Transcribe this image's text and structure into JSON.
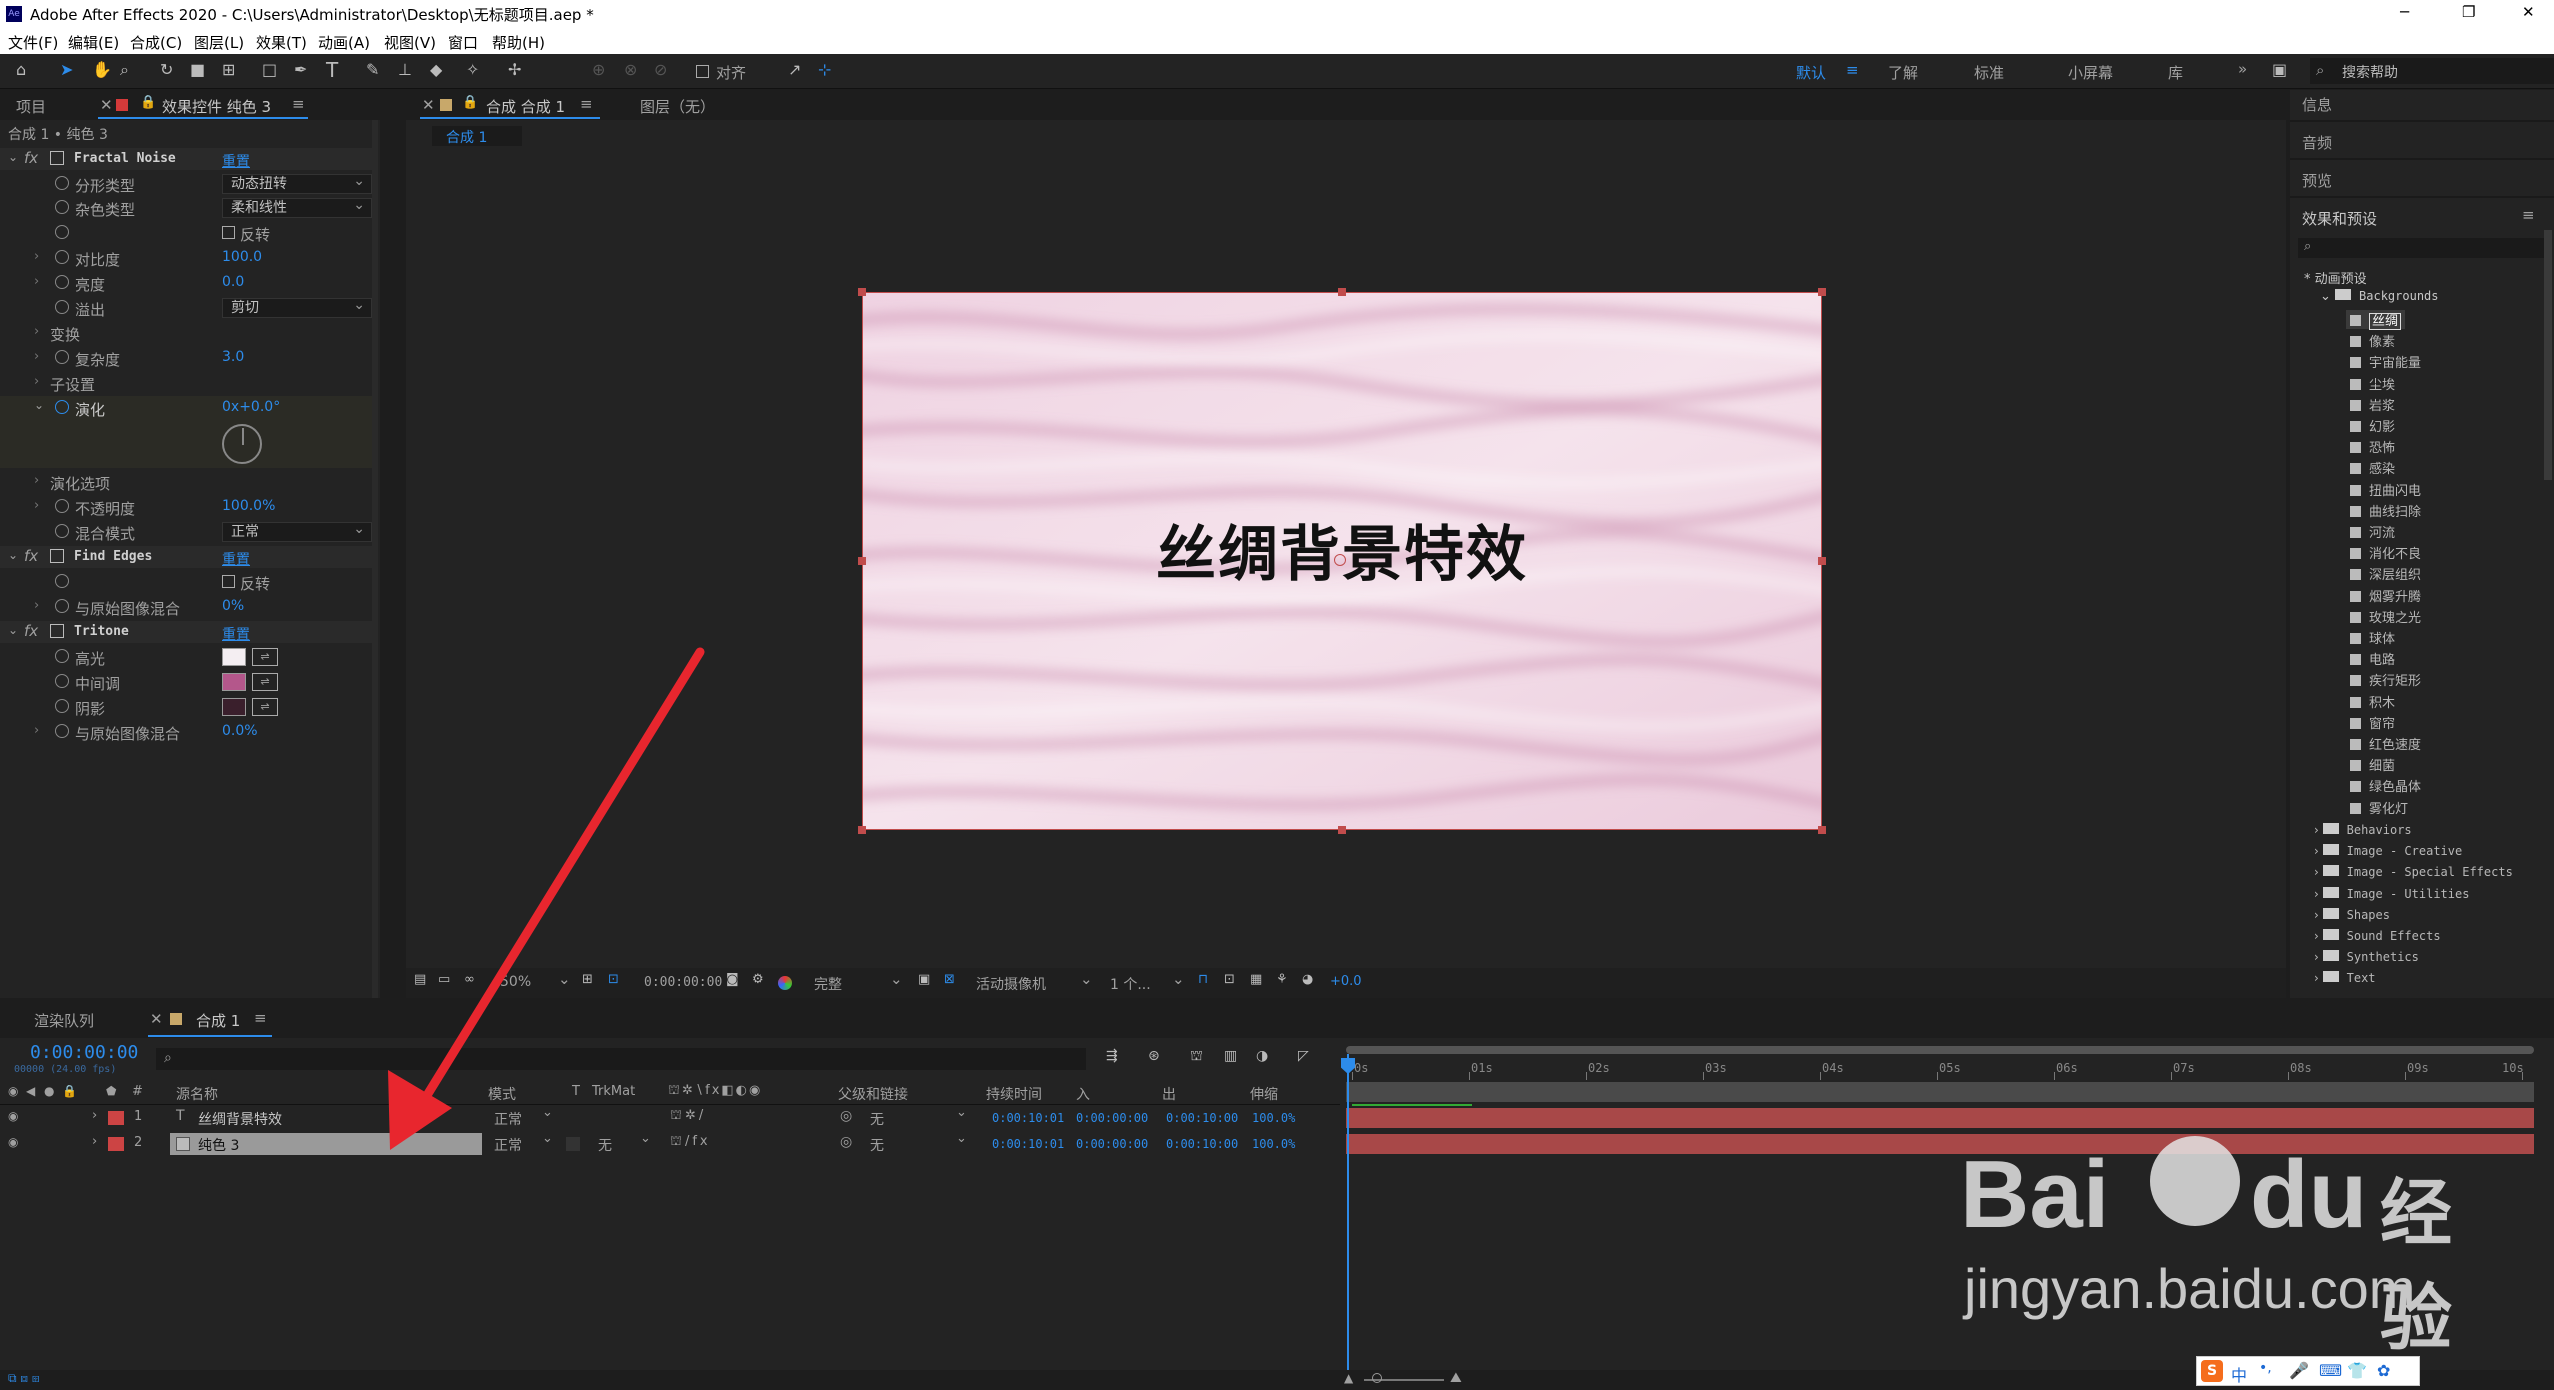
{
  "window": {
    "title": "Adobe After Effects 2020 - C:\\Users\\Administrator\\Desktop\\无标题项目.aep *",
    "controls": {
      "minimize": "─",
      "maximize": "❐",
      "close": "✕"
    }
  },
  "menu": [
    "文件(F)",
    "编辑(E)",
    "合成(C)",
    "图层(L)",
    "效果(T)",
    "动画(A)",
    "视图(V)",
    "窗口",
    "帮助(H)"
  ],
  "toolbar": {
    "align_label": "对齐",
    "workspaces": [
      "默认",
      "了解",
      "标准",
      "小屏幕",
      "库"
    ],
    "more": "»",
    "search_placeholder": "搜索帮助"
  },
  "left_panel": {
    "tab_project": "项目",
    "tab_effects": "效果控件 纯色 3",
    "subtitle": "合成 1 • 纯色 3",
    "reset": "重置",
    "effects": [
      {
        "name": "Fractal Noise"
      },
      {
        "name": "Find Edges"
      },
      {
        "name": "Tritone"
      }
    ],
    "fractal": {
      "fractal_type_label": "分形类型",
      "fractal_type_value": "动态扭转",
      "noise_type_label": "杂色类型",
      "noise_type_value": "柔和线性",
      "invert_label": "反转",
      "contrast_label": "对比度",
      "contrast_value": "100.0",
      "brightness_label": "亮度",
      "brightness_value": "0.0",
      "overflow_label": "溢出",
      "overflow_value": "剪切",
      "transform_label": "变换",
      "complexity_label": "复杂度",
      "complexity_value": "3.0",
      "sub_settings_label": "子设置",
      "evolution_label": "演化",
      "evolution_value": "0x+0.0°",
      "evolution_options_label": "演化选项",
      "opacity_label": "不透明度",
      "opacity_value": "100.0%",
      "blend_label": "混合模式",
      "blend_value": "正常"
    },
    "find_edges": {
      "invert_label": "反转",
      "blend_original_label": "与原始图像混合",
      "blend_original_value": "0%"
    },
    "tritone": {
      "highlights_label": "高光",
      "highlights_color": "#f4eef2",
      "midtones_label": "中间调",
      "midtones_color": "#b4578b",
      "shadows_label": "阴影",
      "shadows_color": "#3a1f2c",
      "blend_original_label": "与原始图像混合",
      "blend_original_value": "0.0%"
    }
  },
  "viewer": {
    "tab_comp": "合成 合成 1",
    "tab_layer": "图层（无）",
    "breadcrumb": "合成 1",
    "comp_text": "丝绸背景特效",
    "zoom": "50%",
    "timecode": "0:00:00:00",
    "resolution": "完整",
    "camera": "活动摄像机",
    "views": "1 个...",
    "exposure": "+0.0"
  },
  "right_panel": {
    "info": "信息",
    "audio": "音频",
    "preview": "预览",
    "effects_presets": "效果和预设",
    "tree_root": "* 动画预设",
    "backgrounds": "Backgrounds",
    "bg_items": [
      "丝绸",
      "像素",
      "宇宙能量",
      "尘埃",
      "岩浆",
      "幻影",
      "恐怖",
      "感染",
      "扭曲闪电",
      "曲线扫除",
      "河流",
      "消化不良",
      "深层组织",
      "烟雾升腾",
      "玫瑰之光",
      "球体",
      "电路",
      "疾行矩形",
      "积木",
      "窗帘",
      "红色速度",
      "细菌",
      "绿色晶体",
      "雾化灯"
    ],
    "folders": [
      "Behaviors",
      "Image - Creative",
      "Image - Special Effects",
      "Image - Utilities",
      "Shapes",
      "Sound Effects",
      "Synthetics",
      "Text"
    ]
  },
  "timeline": {
    "tab_render": "渲染队列",
    "tab_comp": "合成 1",
    "timecode": "0:00:00:00",
    "fps": "00000 (24.00 fps)",
    "columns": {
      "num": "#",
      "source": "源名称",
      "mode": "模式",
      "t": "T",
      "trkmat": "TrkMat",
      "parent": "父级和链接",
      "duration": "持续时间",
      "in": "入",
      "out": "出",
      "stretch": "伸缩"
    },
    "layers": [
      {
        "num": "1",
        "type": "T",
        "name": "丝绸背景特效",
        "mode": "正常",
        "trkmat": "",
        "parent": "无",
        "duration": "0:00:10:01",
        "in": "0:00:00:00",
        "out": "0:00:10:00",
        "stretch": "100.0%"
      },
      {
        "num": "2",
        "type": "",
        "name": "纯色 3",
        "mode": "正常",
        "trkmat": "无",
        "parent": "无",
        "duration": "0:00:10:01",
        "in": "0:00:00:00",
        "out": "0:00:10:00",
        "stretch": "100.0%"
      }
    ],
    "ruler": [
      "0s",
      "01s",
      "02s",
      "03s",
      "04s",
      "05s",
      "06s",
      "07s",
      "08s",
      "09s",
      "10s"
    ]
  },
  "watermark": {
    "brand": "Bai",
    "brand2": "经验",
    "url": "jingyan.baidu.com"
  },
  "ime": {
    "lang": "中",
    "punct": "•,"
  }
}
